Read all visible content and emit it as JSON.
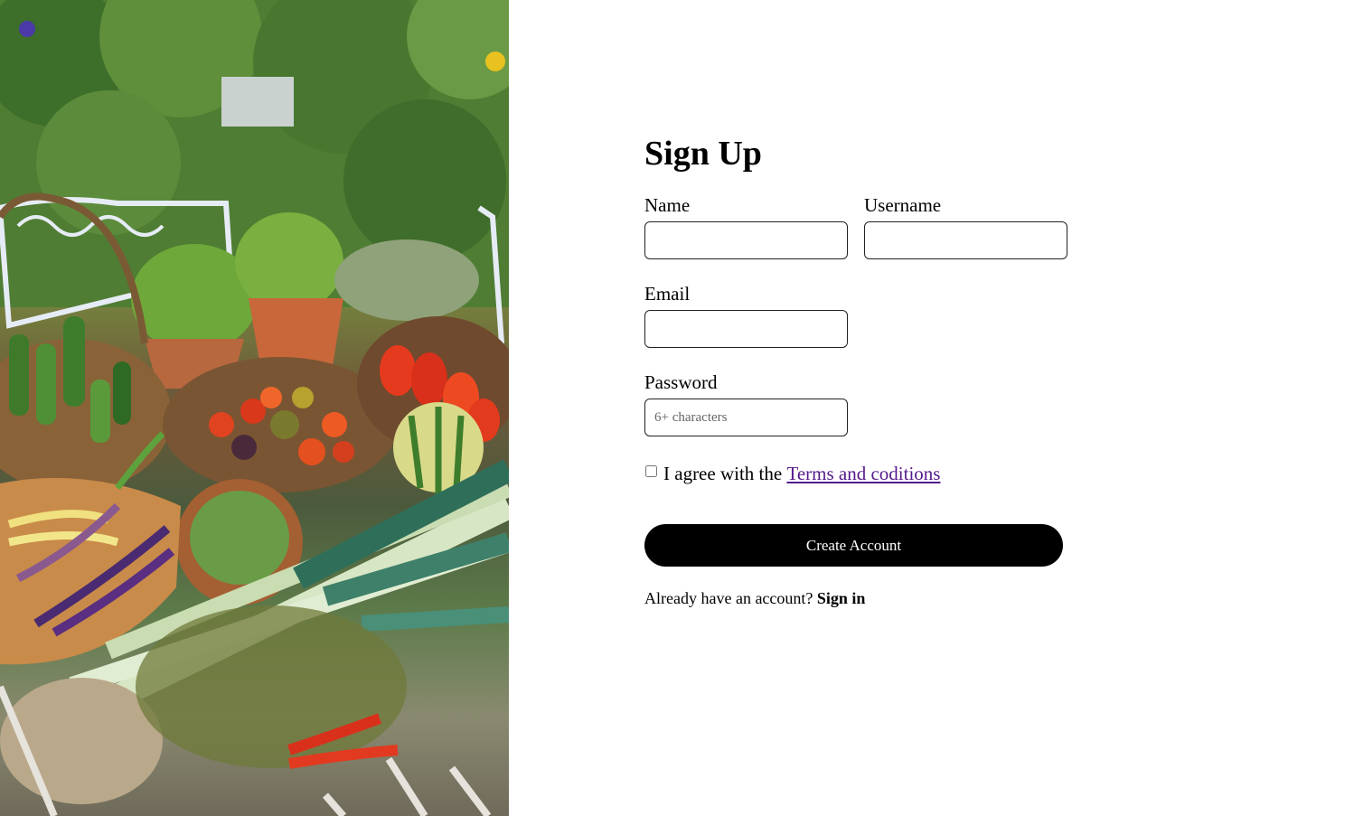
{
  "hero": {
    "image_description": ""
  },
  "signup": {
    "title": "Sign Up",
    "name_label": "Name",
    "name_value": "",
    "username_label": "Username",
    "username_value": "",
    "email_label": "Email",
    "email_value": "",
    "password_label": "Password",
    "password_placeholder": "6+ characters",
    "agree_prefix": "I agree with the",
    "terms_link": "Terms and coditions",
    "create_button": "Create Account",
    "already_text": "Already have an account?",
    "signin_link": "Sign in"
  },
  "colors": {
    "button_bg": "#000000",
    "link": "#551a8b"
  }
}
